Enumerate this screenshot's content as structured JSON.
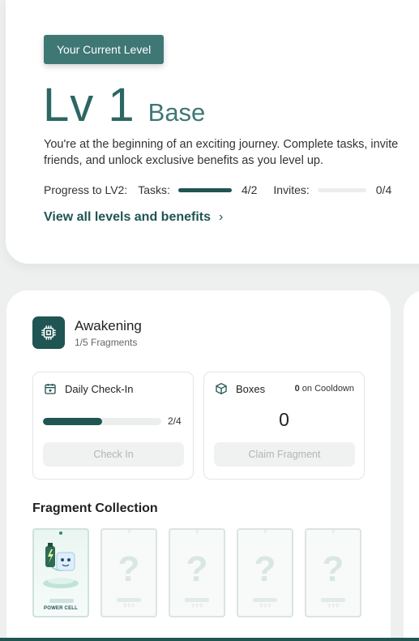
{
  "level": {
    "pill": "Your Current Level",
    "number": "Lv 1",
    "name": "Base",
    "description": "You're at the beginning of an exciting journey. Complete tasks, invite friends, and unlock exclusive benefits as you level up.",
    "progress_label": "Progress to LV2:",
    "tasks_label": "Tasks:",
    "tasks_count": "4/2",
    "tasks_progress": 1.0,
    "invites_label": "Invites:",
    "invites_count": "0/4",
    "invites_progress": 0.0,
    "link": "View all levels and benefits",
    "link_chevron": "›"
  },
  "awakening": {
    "title": "Awakening",
    "subtitle": "1/5 Fragments",
    "icon": "chip-icon"
  },
  "checkin": {
    "label": "Daily Check-In",
    "count": "2/4",
    "progress": 0.5,
    "button": "Check In"
  },
  "boxes": {
    "label": "Boxes",
    "cooldown_num": "0",
    "cooldown_text": "on Cooldown",
    "count": "0",
    "button": "Claim Fragment"
  },
  "fragments": {
    "title": "Fragment Collection",
    "items": [
      {
        "name": "POWER CELL",
        "owned": true
      },
      {
        "name": "? ? ?",
        "owned": false,
        "mark": "?",
        "top_mark": "?"
      },
      {
        "name": "? ? ?",
        "owned": false,
        "mark": "?",
        "top_mark": "?"
      },
      {
        "name": "? ? ?",
        "owned": false,
        "mark": "?",
        "top_mark": "?"
      },
      {
        "name": "? ? ?",
        "owned": false,
        "mark": "?",
        "top_mark": "?"
      }
    ]
  },
  "colors": {
    "accent": "#1f5552",
    "pill": "#3f7775"
  }
}
